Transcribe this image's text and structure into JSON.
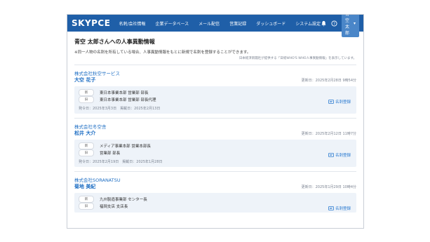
{
  "app": {
    "logo": "SKYPCE"
  },
  "nav": [
    "名刺/会社情報",
    "企業データベース",
    "メール配信",
    "営業記録",
    "ダッシュボード",
    "システム設定"
  ],
  "user": {
    "name": "青空 太郎",
    "chevron": "▾"
  },
  "icons": {
    "bell": "bell-icon",
    "help": "help-icon",
    "card": "namecard-icon"
  },
  "page": {
    "title": "青空 太郎さんへの人事異動情報",
    "note": "※同一人物の名刺を所有している場合、人事異動情報をもとに新規で名刺を登録することができます。",
    "sub_note": "日本経済新聞社が提供する「日経WHO'S WHO人事異動情報」を表示しています。"
  },
  "entries": [
    {
      "company": "株式会社秋空サービス",
      "person": "大空 花子",
      "updated": "更新日：2025年2月28日 9時54分",
      "new_label": "新",
      "new_position": "東日本事業本部 営業部 部長",
      "old_label": "旧",
      "old_position": "東日本事業本部 営業部 部長代理",
      "button": "名刺登録",
      "dates": "発令日：2025年3月3日　掲載日：2025年2月13日"
    },
    {
      "company": "株式会社冬空舎",
      "person": "松井 大介",
      "updated": "更新日：2025年2月12日 11時7分",
      "new_label": "新",
      "new_position": "メディア事業本部 営業本部長",
      "old_label": "旧",
      "old_position": "営業部 部長",
      "button": "名刺登録",
      "dates": "発令日：2025年2月19日　掲載日：2025年1月28日"
    },
    {
      "company": "株式会社SORANATSU",
      "person": "菊地 美紀",
      "updated": "更新日：2025年1月29日 10時4分",
      "new_label": "新",
      "new_position": "九州製造事業部 センター長",
      "old_label": "旧",
      "old_position": "福岡支店 支店長",
      "button": "名刺登録",
      "dates": ""
    }
  ]
}
